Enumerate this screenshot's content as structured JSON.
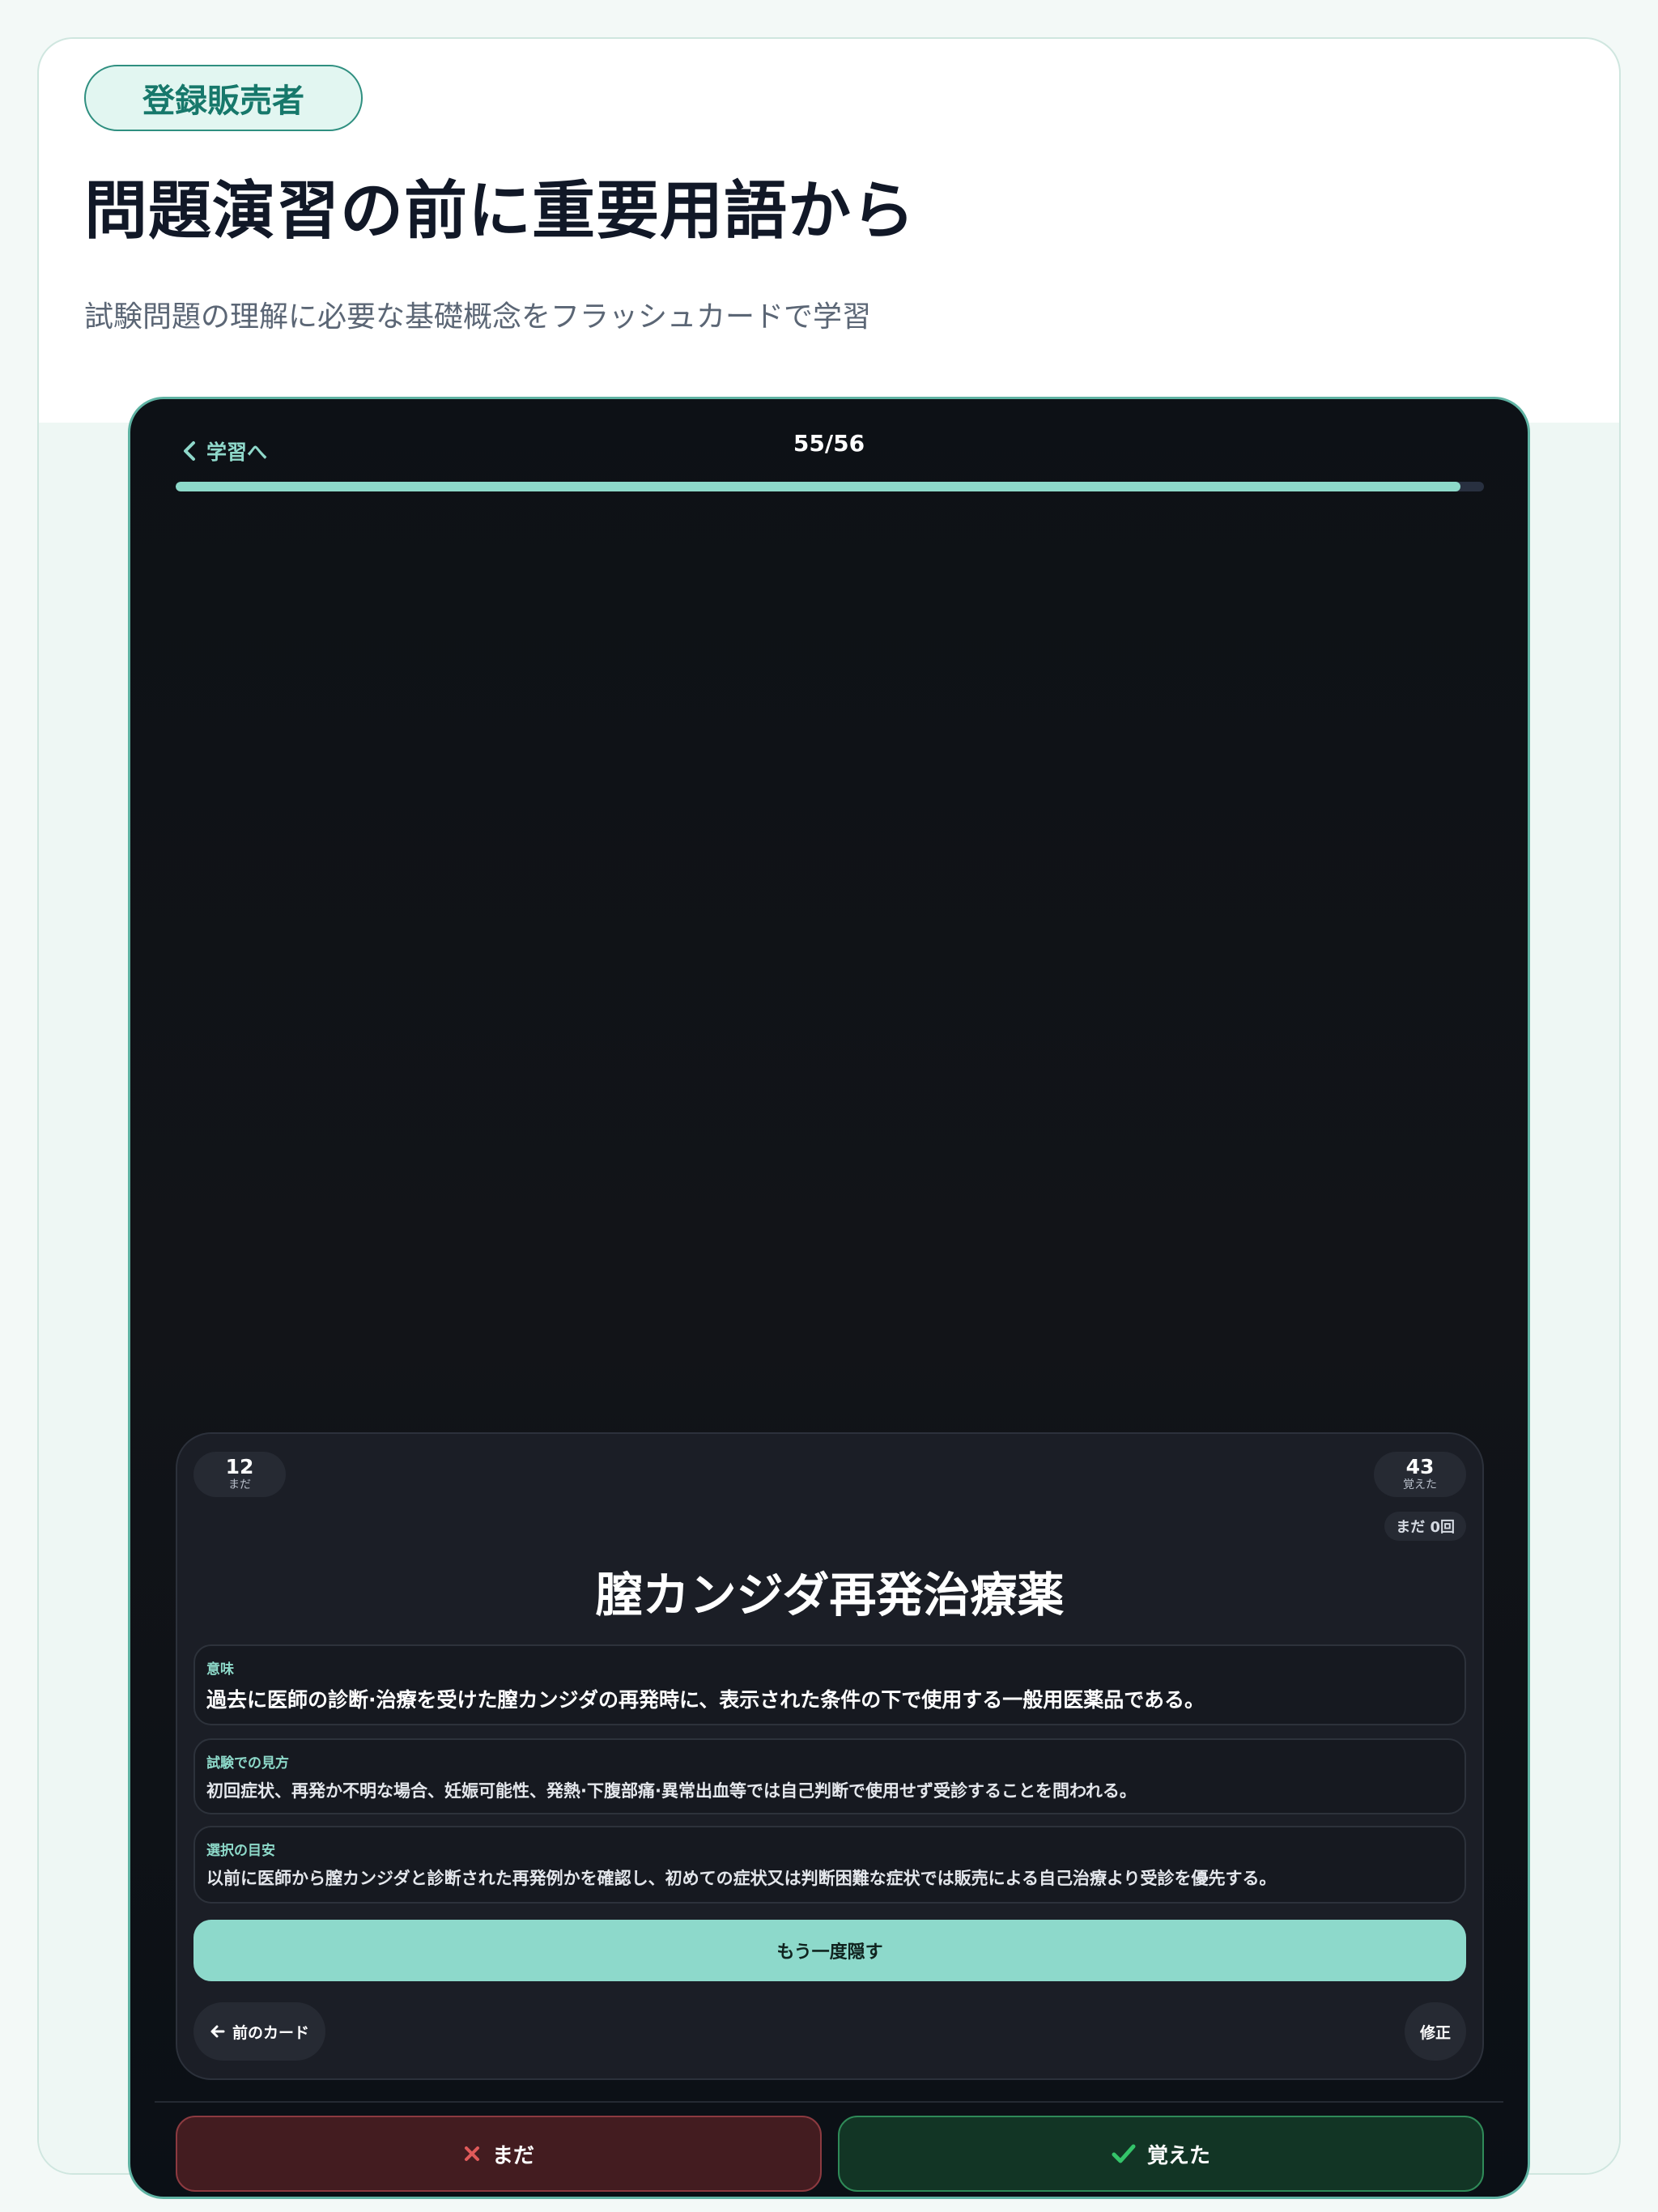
{
  "header": {
    "badge": "登録販売者",
    "title": "問題演習の前に重要用語から",
    "subtitle": "試験問題の理解に必要な基礎概念をフラッシュカードで学習"
  },
  "app": {
    "back_label": "学習へ",
    "counter": "55/56",
    "progress": 0.982,
    "colors": {
      "accent": "#8dd9c9",
      "danger": "#e05a5a",
      "success": "#34c46a"
    }
  },
  "card": {
    "not_yet_count": "12",
    "not_yet_label": "まだ",
    "known_count": "43",
    "known_label": "覚えた",
    "tries": "まだ 0回",
    "term": "膣カンジダ再発治療薬",
    "sections": [
      {
        "label": "意味",
        "text": "過去に医師の診断·治療を受けた膣カンジダの再発時に、表示された条件の下で使用する一般用医薬品である。"
      },
      {
        "label": "試験での見方",
        "text": "初回症状、再発か不明な場合、妊娠可能性、発熱·下腹部痛·異常出血等では自己判断で使用せず受診することを問われる。"
      },
      {
        "label": "選択の目安",
        "text": "以前に医師から膣カンジダと診断された再発例かを確認し、初めての症状又は判断困難な症状では販売による自己治療より受診を優先する。"
      }
    ],
    "hide_button": "もう一度隠す",
    "prev_button": "前のカード",
    "edit_button": "修正"
  },
  "actions": {
    "not_yet": "まだ",
    "known": "覚えた"
  }
}
